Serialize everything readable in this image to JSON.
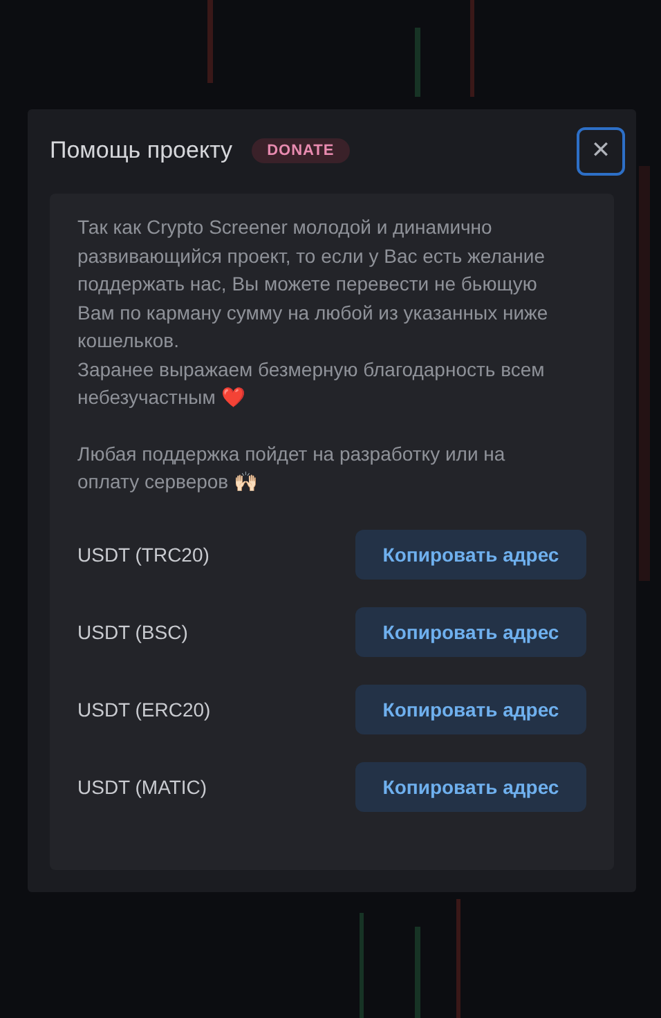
{
  "dialog": {
    "title": "Помощь проекту",
    "badge": "DONATE",
    "close": "✕",
    "paragraphs": [
      "Так как Crypto Screener молодой и динамично развивающийся проект, то если у Вас есть желание поддержать нас, Вы можете перевести не бьющую Вам по карману сумму на любой из указанных ниже кошельков.\nЗаранее выражаем безмерную благодарность всем небезучастным ❤️",
      "Любая поддержка пойдет на разработку или на оплату серверов 🙌🏻"
    ],
    "wallets": [
      {
        "name": "USDT (TRC20)",
        "button": "Копировать адрес"
      },
      {
        "name": "USDT (BSC)",
        "button": "Копировать адрес"
      },
      {
        "name": "USDT (ERC20)",
        "button": "Копировать адрес"
      },
      {
        "name": "USDT (MATIC)",
        "button": "Копировать адрес"
      }
    ]
  }
}
